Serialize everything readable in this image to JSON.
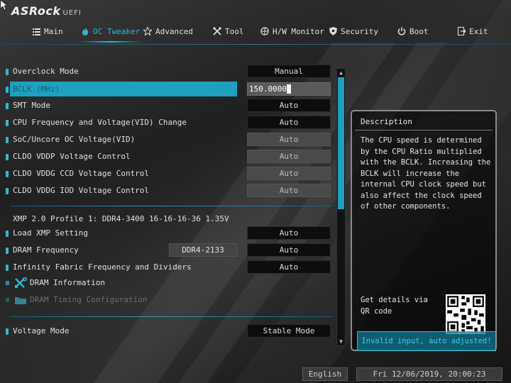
{
  "header": {
    "brand": "ASRock",
    "brand_suffix": "UEFI"
  },
  "nav": [
    {
      "label": "Main",
      "icon": "list-icon"
    },
    {
      "label": "OC Tweaker",
      "icon": "flame-icon",
      "active": true
    },
    {
      "label": "Advanced",
      "icon": "star-icon"
    },
    {
      "label": "Tool",
      "icon": "wrench-icon"
    },
    {
      "label": "H/W Monitor",
      "icon": "monitor-icon"
    },
    {
      "label": "Security",
      "icon": "shield-icon"
    },
    {
      "label": "Boot",
      "icon": "power-icon"
    },
    {
      "label": "Exit",
      "icon": "exit-door-icon"
    }
  ],
  "settings": [
    {
      "label": "Overclock Mode",
      "value": "Manual"
    },
    {
      "label": "BCLK (MHz)",
      "value": "150.0000"
    },
    {
      "label": "SMT Mode",
      "value": "Auto"
    },
    {
      "label": "CPU Frequency and Voltage(VID) Change",
      "value": "Auto"
    },
    {
      "label": "SoC/Uncore OC Voltage(VID)",
      "value": "Auto"
    },
    {
      "label": "CLDO VDDP Voltage Control",
      "value": "Auto"
    },
    {
      "label": "CLDO VDDG CCD Voltage Control",
      "value": "Auto"
    },
    {
      "label": "CLDO VDDG IOD Voltage Control",
      "value": "Auto"
    }
  ],
  "xmp_info": "XMP 2.0 Profile 1: DDR4-3400 16-16-16-36 1.35V",
  "memory_settings": [
    {
      "label": "Load XMP Setting",
      "value": "Auto"
    },
    {
      "label": "DRAM Frequency",
      "value": "Auto",
      "current": "DDR4-2133"
    },
    {
      "label": "Infinity Fabric Frequency and Dividers",
      "value": "Auto"
    }
  ],
  "submenus": [
    {
      "label": "DRAM Information",
      "icon": "tools-icon"
    },
    {
      "label": "DRAM Timing Configuration",
      "icon": "folder-icon",
      "disabled": true
    }
  ],
  "voltage_mode": {
    "label": "Voltage Mode",
    "value": "Stable Mode"
  },
  "description": {
    "title": "Description",
    "text": "The CPU speed is determined by the CPU Ratio multiplied with the BCLK. Increasing the BCLK will increase the internal CPU clock speed but also affect the clock speed of other components.",
    "qr_caption": "Get details via QR code"
  },
  "toast": "Invalid input, auto adjusted!",
  "footer": {
    "language": "English",
    "datetime": "Fri 12/06/2019, 20:00:23"
  },
  "colors": {
    "accent": "#2fb8d6",
    "selection": "#1ea0bf"
  }
}
